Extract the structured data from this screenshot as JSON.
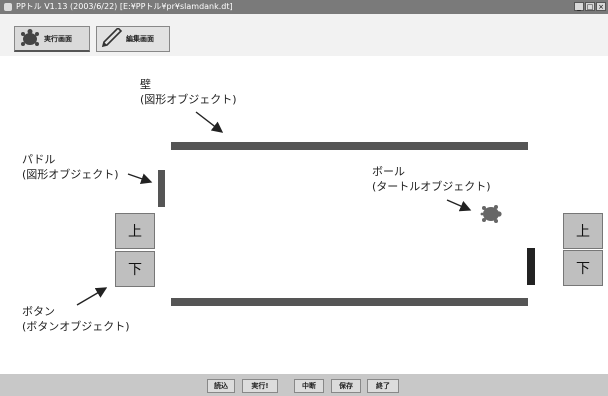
{
  "window": {
    "title": "PPトル V1.13 (2003/6/22) [E:¥PPトル¥pr¥slamdank.dt]",
    "minimize": "_",
    "maximize": "□",
    "close": "×"
  },
  "tabs": [
    {
      "label": "実行画面",
      "icon": "turtle-icon"
    },
    {
      "label": "編集画面",
      "icon": "pen-icon"
    }
  ],
  "annotations": {
    "wall_line1": "壁",
    "wall_line2": "(図形オブジェクト)",
    "paddle_line1": "パドル",
    "paddle_line2": "(図形オブジェクト)",
    "ball_line1": "ボール",
    "ball_line2": "(タートルオブジェクト)",
    "button_line1": "ボタン",
    "button_line2": "(ボタンオブジェクト)"
  },
  "left_controls": {
    "up": "上",
    "down": "下"
  },
  "right_controls": {
    "up": "上",
    "down": "下"
  },
  "bottom_buttons": [
    "読込",
    "実行!",
    "中断",
    "保存",
    "終了"
  ],
  "colors": {
    "bar": "#555555",
    "button": "#bfbfbf",
    "titlebar": "#7a7a7a"
  }
}
